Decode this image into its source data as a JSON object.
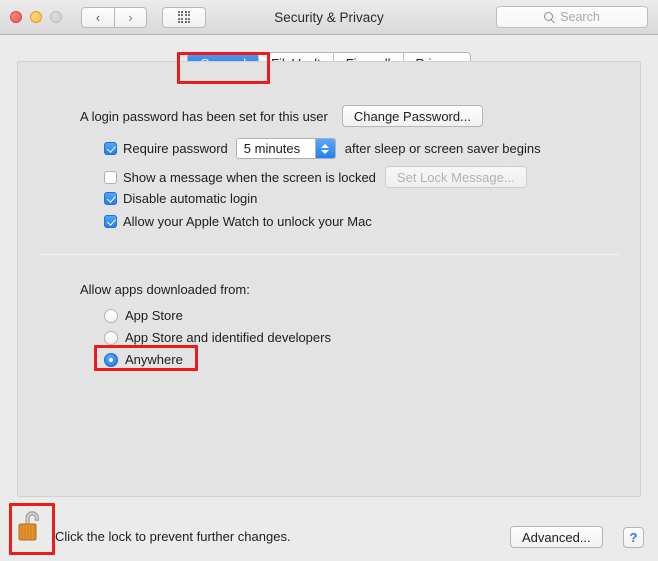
{
  "window": {
    "title": "Security & Privacy",
    "traffic_lights": [
      "close",
      "minimize",
      "zoom-disabled"
    ],
    "nav_back_icon": "chevron-left-icon",
    "nav_forward_icon": "chevron-right-icon",
    "show_all_icon": "grid-icon",
    "search": {
      "placeholder": "Search",
      "value": "",
      "icon": "search-icon"
    }
  },
  "tabs": [
    {
      "label": "General",
      "selected": true
    },
    {
      "label": "FileVault",
      "selected": false
    },
    {
      "label": "Firewall",
      "selected": false
    },
    {
      "label": "Privacy",
      "selected": false
    }
  ],
  "login": {
    "status_text": "A login password has been set for this user",
    "change_password_label": "Change Password...",
    "require_password": {
      "checked": true,
      "label_before": "Require password",
      "interval_value": "5 minutes",
      "label_after": "after sleep or screen saver begins",
      "stepper_icon": "stepper-up-down-icon"
    },
    "show_message": {
      "checked": false,
      "label": "Show a message when the screen is locked",
      "button_label": "Set Lock Message...",
      "button_disabled": true
    },
    "disable_auto_login": {
      "checked": true,
      "label": "Disable automatic login"
    },
    "apple_watch": {
      "checked": true,
      "label": "Allow your Apple Watch to unlock your Mac"
    }
  },
  "gatekeeper": {
    "heading": "Allow apps downloaded from:",
    "options": [
      {
        "label": "App Store",
        "selected": false
      },
      {
        "label": "App Store and identified developers",
        "selected": false
      },
      {
        "label": "Anywhere",
        "selected": true
      }
    ]
  },
  "footer": {
    "lock_icon": "unlocked-padlock-icon",
    "lock_message": "Click the lock to prevent further changes.",
    "advanced_label": "Advanced...",
    "help_label": "?"
  },
  "annotations": {
    "accent_color": "#ec1c1c",
    "boxes": [
      "general-tab",
      "anywhere-radio",
      "lock-icon"
    ]
  }
}
